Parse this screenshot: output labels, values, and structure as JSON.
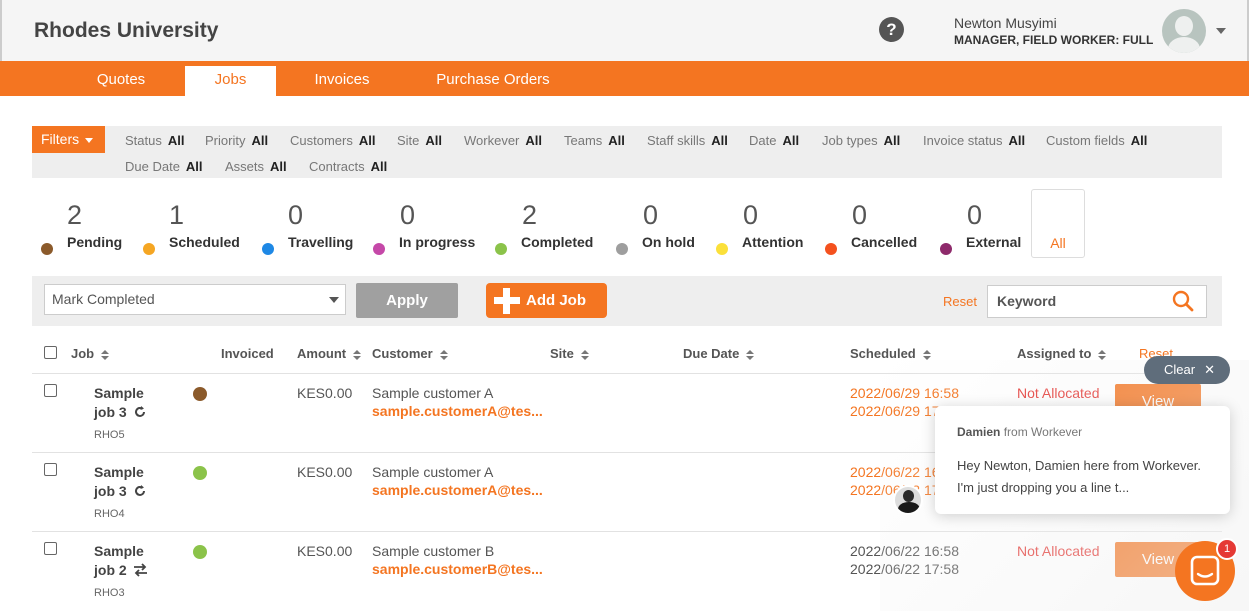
{
  "header": {
    "brand": "Rhodes University",
    "help_icon": "?",
    "user_name": "Newton Musyimi",
    "user_role": "MANAGER, FIELD WORKER: FULL"
  },
  "nav": {
    "tabs": [
      {
        "label": "Quotes"
      },
      {
        "label": "Jobs"
      },
      {
        "label": "Invoices"
      },
      {
        "label": "Purchase Orders"
      }
    ],
    "active": "Jobs"
  },
  "filters": {
    "button": "Filters",
    "items": [
      {
        "label": "Status",
        "value": "All"
      },
      {
        "label": "Priority",
        "value": "All"
      },
      {
        "label": "Customers",
        "value": "All"
      },
      {
        "label": "Site",
        "value": "All"
      },
      {
        "label": "Workever",
        "value": "All"
      },
      {
        "label": "Teams",
        "value": "All"
      },
      {
        "label": "Staff skills",
        "value": "All"
      },
      {
        "label": "Date",
        "value": "All"
      },
      {
        "label": "Job types",
        "value": "All"
      },
      {
        "label": "Invoice status",
        "value": "All"
      },
      {
        "label": "Custom fields",
        "value": "All"
      },
      {
        "label": "Due Date",
        "value": "All"
      },
      {
        "label": "Assets",
        "value": "All"
      },
      {
        "label": "Contracts",
        "value": "All"
      }
    ]
  },
  "status_counts": [
    {
      "count": "2",
      "label": "Pending",
      "color": "#8b5a2b"
    },
    {
      "count": "1",
      "label": "Scheduled",
      "color": "#f5a623"
    },
    {
      "count": "0",
      "label": "Travelling",
      "color": "#1e88e5"
    },
    {
      "count": "0",
      "label": "In progress",
      "color": "#c548a8"
    },
    {
      "count": "2",
      "label": "Completed",
      "color": "#8bc34a"
    },
    {
      "count": "0",
      "label": "On hold",
      "color": "#9e9e9e"
    },
    {
      "count": "0",
      "label": "Attention",
      "color": "#fbe03a"
    },
    {
      "count": "0",
      "label": "Cancelled",
      "color": "#f4511e"
    },
    {
      "count": "0",
      "label": "External",
      "color": "#8e2a6b"
    }
  ],
  "status_all_label": "All",
  "actionbar": {
    "bulk_action": "Mark Completed",
    "apply": "Apply",
    "add_job": "Add Job",
    "reset": "Reset",
    "keyword_placeholder": "Keyword"
  },
  "table": {
    "columns": [
      "Job",
      "Invoiced",
      "Amount",
      "Customer",
      "Site",
      "Due Date",
      "Scheduled",
      "Assigned to"
    ],
    "reset": "Reset",
    "rows": [
      {
        "job_line1": "Sample",
        "job_line2": "job 3",
        "job_icon": "recurring-icon",
        "code": "RHO5",
        "status_color": "#8b5a2b",
        "amount": "KES0.00",
        "customer": "Sample customer A",
        "email": "sample.customerA@tes...",
        "scheduled_start": "2022/06/29 16:58",
        "scheduled_end": "2022/06/29 17:58",
        "assigned": "Not Allocated",
        "view": "View"
      },
      {
        "job_line1": "Sample",
        "job_line2": "job 3",
        "job_icon": "recurring-icon",
        "code": "RHO4",
        "status_color": "#8bc34a",
        "amount": "KES0.00",
        "customer": "Sample customer A",
        "email": "sample.customerA@tes...",
        "scheduled_start": "2022/06/22 16:58",
        "scheduled_end": "2022/06/22 17:58",
        "assigned": "",
        "view": ""
      },
      {
        "job_line1": "Sample",
        "job_line2": "job 2",
        "job_icon": "transfer-icon",
        "code": "RHO3",
        "status_color": "#8bc34a",
        "amount": "KES0.00",
        "customer": "Sample customer B",
        "email": "sample.customerB@tes...",
        "scheduled_start": "2022/06/22 16:58",
        "scheduled_end": "2022/06/22 17:58",
        "assigned": "Not Allocated",
        "view": "View"
      }
    ]
  },
  "chat": {
    "clear": "Clear",
    "from_name": "Damien",
    "from_suffix": "from Workever",
    "message": "Hey Newton, Damien here from Workever. I'm just dropping you a line t...",
    "badge": "1"
  },
  "colors": {
    "accent": "#f47521",
    "danger": "#e53935"
  }
}
